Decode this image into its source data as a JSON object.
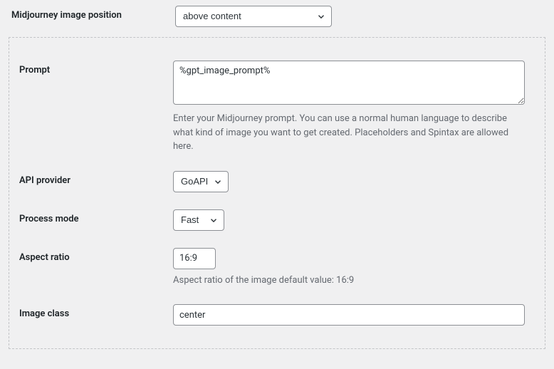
{
  "position": {
    "label": "Midjourney image position",
    "value": "above content"
  },
  "panel": {
    "prompt": {
      "label": "Prompt",
      "value": "%gpt_image_prompt%",
      "desc": "Enter your Midjourney prompt. You can use a normal human language to describe what kind of image you want to get created. Placeholders and Spintax are allowed here."
    },
    "api_provider": {
      "label": "API provider",
      "value": "GoAPI"
    },
    "process_mode": {
      "label": "Process mode",
      "value": "Fast"
    },
    "aspect_ratio": {
      "label": "Aspect ratio",
      "value": "16:9",
      "desc": "Aspect ratio of the image default value: 16:9"
    },
    "image_class": {
      "label": "Image class",
      "value": "center"
    }
  }
}
